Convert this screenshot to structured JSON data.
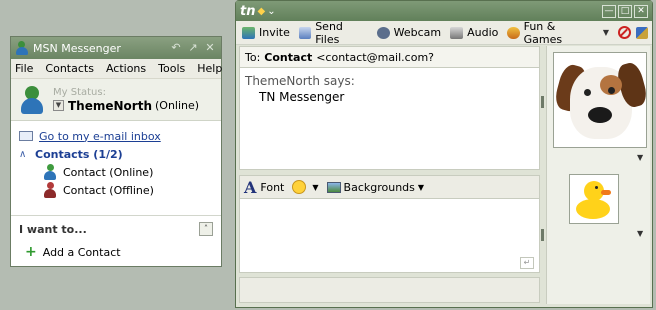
{
  "msn": {
    "title": "MSN Messenger",
    "menu": [
      "File",
      "Contacts",
      "Actions",
      "Tools",
      "Help"
    ],
    "status_label": "My Status:",
    "user_name": "ThemeNorth",
    "user_state": "(Online)",
    "inbox_link": "Go to my e-mail inbox",
    "group_label": "Contacts (1/2)",
    "contacts": [
      {
        "label": "Contact (Online)",
        "status": "online"
      },
      {
        "label": "Contact (Offline)",
        "status": "offline"
      }
    ],
    "iwant_label": "I want to...",
    "add_contact": "Add a Contact"
  },
  "conv": {
    "logo": "tn",
    "toolbar": {
      "invite": "Invite",
      "send_files": "Send Files",
      "webcam": "Webcam",
      "audio": "Audio",
      "fun_games": "Fun & Games"
    },
    "to_label": "To:",
    "to_name": "Contact",
    "to_email": "<contact@mail.com?",
    "says": "ThemeNorth says:",
    "message": "TN Messenger",
    "font_label": "Font",
    "backgrounds_label": "Backgrounds"
  },
  "colors": {
    "title_bar": "#6b8563",
    "link": "#1c3f94",
    "online": "#3f9b3f",
    "offline": "#b23a3a"
  }
}
